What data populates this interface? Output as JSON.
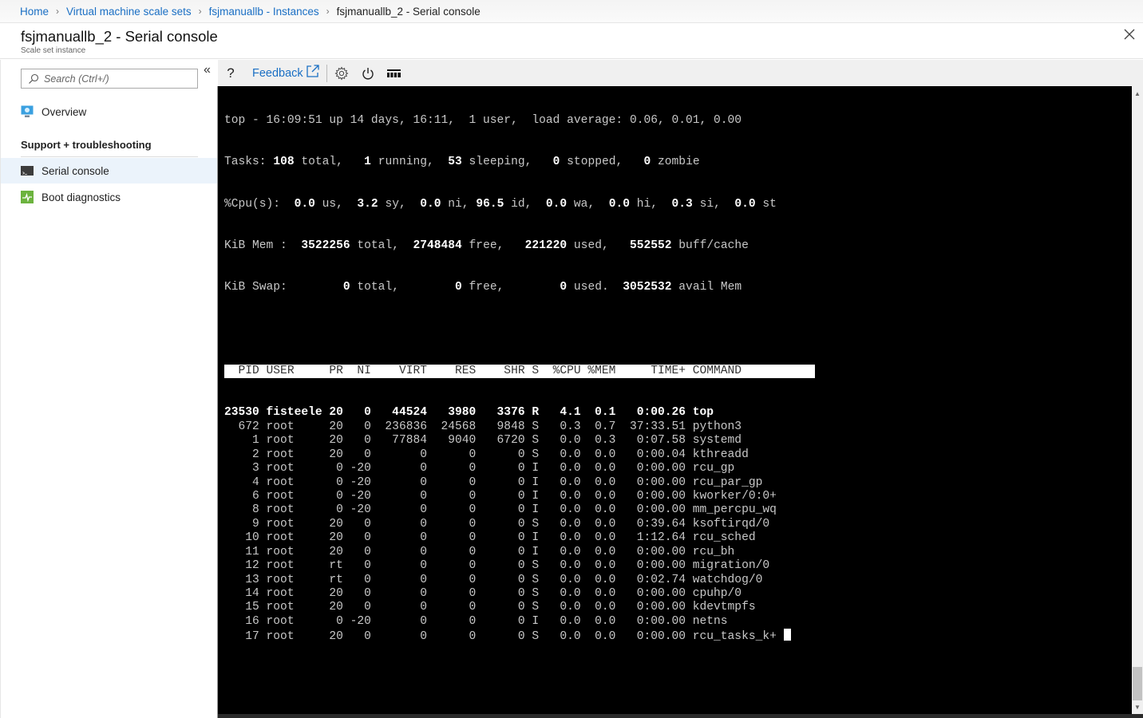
{
  "breadcrumb": {
    "items": [
      "Home",
      "Virtual machine scale sets",
      "fsjmanuallb - Instances"
    ],
    "current": "fsjmanuallb_2 - Serial console"
  },
  "header": {
    "title": "fsjmanuallb_2 - Serial console",
    "subtitle": "Scale set instance"
  },
  "sidebar": {
    "search_placeholder": "Search (Ctrl+/)",
    "overview_label": "Overview",
    "section_label": "Support + troubleshooting",
    "items": [
      {
        "label": "Serial console",
        "icon": "console-icon",
        "active": true
      },
      {
        "label": "Boot diagnostics",
        "icon": "boot-diagnostics-icon",
        "active": false
      }
    ]
  },
  "toolbar": {
    "help_label": "?",
    "feedback_label": "Feedback",
    "icons": [
      "help-icon",
      "external-link-icon",
      "gear-icon",
      "power-icon",
      "keyboard-icon"
    ]
  },
  "terminal": {
    "summary": {
      "line1": "top - 16:09:51 up 14 days, 16:11,  1 user,  load average: 0.06, 0.01, 0.00",
      "tasks": {
        "total": "108",
        "running": "1",
        "sleeping": "53",
        "stopped": "0",
        "zombie": "0"
      },
      "cpu": {
        "us": "0.0",
        "sy": "3.2",
        "ni": "0.0",
        "id": "96.5",
        "wa": "0.0",
        "hi": "0.0",
        "si": "0.3",
        "st": "0.0"
      },
      "mem": {
        "total": "3522256",
        "free": "2748484",
        "used": "221220",
        "buff_cache": "552552"
      },
      "swap": {
        "total": "0",
        "free": "0",
        "used": "0",
        "avail_mem": "3052532"
      }
    },
    "columns": [
      "PID",
      "USER",
      "PR",
      "NI",
      "VIRT",
      "RES",
      "SHR",
      "S",
      "%CPU",
      "%MEM",
      "TIME+",
      "COMMAND"
    ],
    "processes": [
      [
        "23530",
        "fisteele",
        "20",
        "0",
        "44524",
        "3980",
        "3376",
        "R",
        "4.1",
        "0.1",
        "0:00.26",
        "top"
      ],
      [
        "672",
        "root",
        "20",
        "0",
        "236836",
        "24568",
        "9848",
        "S",
        "0.3",
        "0.7",
        "37:33.51",
        "python3"
      ],
      [
        "1",
        "root",
        "20",
        "0",
        "77884",
        "9040",
        "6720",
        "S",
        "0.0",
        "0.3",
        "0:07.58",
        "systemd"
      ],
      [
        "2",
        "root",
        "20",
        "0",
        "0",
        "0",
        "0",
        "S",
        "0.0",
        "0.0",
        "0:00.04",
        "kthreadd"
      ],
      [
        "3",
        "root",
        "0",
        "-20",
        "0",
        "0",
        "0",
        "I",
        "0.0",
        "0.0",
        "0:00.00",
        "rcu_gp"
      ],
      [
        "4",
        "root",
        "0",
        "-20",
        "0",
        "0",
        "0",
        "I",
        "0.0",
        "0.0",
        "0:00.00",
        "rcu_par_gp"
      ],
      [
        "6",
        "root",
        "0",
        "-20",
        "0",
        "0",
        "0",
        "I",
        "0.0",
        "0.0",
        "0:00.00",
        "kworker/0:0+"
      ],
      [
        "8",
        "root",
        "0",
        "-20",
        "0",
        "0",
        "0",
        "I",
        "0.0",
        "0.0",
        "0:00.00",
        "mm_percpu_wq"
      ],
      [
        "9",
        "root",
        "20",
        "0",
        "0",
        "0",
        "0",
        "S",
        "0.0",
        "0.0",
        "0:39.64",
        "ksoftirqd/0"
      ],
      [
        "10",
        "root",
        "20",
        "0",
        "0",
        "0",
        "0",
        "I",
        "0.0",
        "0.0",
        "1:12.64",
        "rcu_sched"
      ],
      [
        "11",
        "root",
        "20",
        "0",
        "0",
        "0",
        "0",
        "I",
        "0.0",
        "0.0",
        "0:00.00",
        "rcu_bh"
      ],
      [
        "12",
        "root",
        "rt",
        "0",
        "0",
        "0",
        "0",
        "S",
        "0.0",
        "0.0",
        "0:00.00",
        "migration/0"
      ],
      [
        "13",
        "root",
        "rt",
        "0",
        "0",
        "0",
        "0",
        "S",
        "0.0",
        "0.0",
        "0:02.74",
        "watchdog/0"
      ],
      [
        "14",
        "root",
        "20",
        "0",
        "0",
        "0",
        "0",
        "S",
        "0.0",
        "0.0",
        "0:00.00",
        "cpuhp/0"
      ],
      [
        "15",
        "root",
        "20",
        "0",
        "0",
        "0",
        "0",
        "S",
        "0.0",
        "0.0",
        "0:00.00",
        "kdevtmpfs"
      ],
      [
        "16",
        "root",
        "0",
        "-20",
        "0",
        "0",
        "0",
        "I",
        "0.0",
        "0.0",
        "0:00.00",
        "netns"
      ],
      [
        "17",
        "root",
        "20",
        "0",
        "0",
        "0",
        "0",
        "S",
        "0.0",
        "0.0",
        "0:00.00",
        "rcu_tasks_k+"
      ]
    ]
  },
  "colors": {
    "link": "#1a6fc4",
    "active_nav_bg": "#ebf3fb",
    "terminal_bg": "#000000",
    "terminal_fg": "#c8c8c8"
  }
}
